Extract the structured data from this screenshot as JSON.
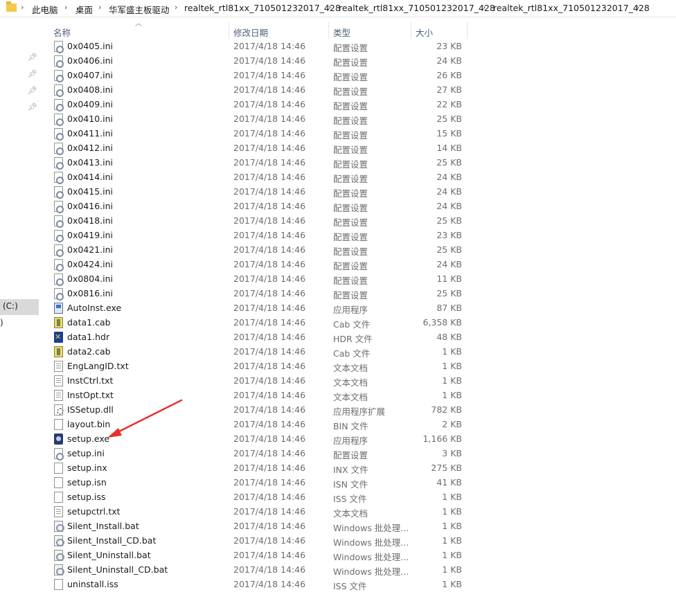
{
  "breadcrumb": {
    "items": [
      "此电脑",
      "桌面",
      "华军盛主板驱动",
      "realtek_rtl81xx_710501232017_428",
      "realtek_rtl81xx_710501232017_428",
      "realtek_rtl81xx_710501232017_428"
    ]
  },
  "nav": {
    "drive_c": "(C:)",
    "partial": ")"
  },
  "columns": {
    "name": "名称",
    "date": "修改日期",
    "type": "类型",
    "size": "大小"
  },
  "files": [
    {
      "name": "0x0405.ini",
      "date": "2017/4/18 14:46",
      "type": "配置设置",
      "size": "23 KB",
      "icon": "ini"
    },
    {
      "name": "0x0406.ini",
      "date": "2017/4/18 14:46",
      "type": "配置设置",
      "size": "24 KB",
      "icon": "ini"
    },
    {
      "name": "0x0407.ini",
      "date": "2017/4/18 14:46",
      "type": "配置设置",
      "size": "26 KB",
      "icon": "ini"
    },
    {
      "name": "0x0408.ini",
      "date": "2017/4/18 14:46",
      "type": "配置设置",
      "size": "27 KB",
      "icon": "ini"
    },
    {
      "name": "0x0409.ini",
      "date": "2017/4/18 14:46",
      "type": "配置设置",
      "size": "22 KB",
      "icon": "ini"
    },
    {
      "name": "0x0410.ini",
      "date": "2017/4/18 14:46",
      "type": "配置设置",
      "size": "25 KB",
      "icon": "ini"
    },
    {
      "name": "0x0411.ini",
      "date": "2017/4/18 14:46",
      "type": "配置设置",
      "size": "15 KB",
      "icon": "ini"
    },
    {
      "name": "0x0412.ini",
      "date": "2017/4/18 14:46",
      "type": "配置设置",
      "size": "14 KB",
      "icon": "ini"
    },
    {
      "name": "0x0413.ini",
      "date": "2017/4/18 14:46",
      "type": "配置设置",
      "size": "25 KB",
      "icon": "ini"
    },
    {
      "name": "0x0414.ini",
      "date": "2017/4/18 14:46",
      "type": "配置设置",
      "size": "24 KB",
      "icon": "ini"
    },
    {
      "name": "0x0415.ini",
      "date": "2017/4/18 14:46",
      "type": "配置设置",
      "size": "24 KB",
      "icon": "ini"
    },
    {
      "name": "0x0416.ini",
      "date": "2017/4/18 14:46",
      "type": "配置设置",
      "size": "24 KB",
      "icon": "ini"
    },
    {
      "name": "0x0418.ini",
      "date": "2017/4/18 14:46",
      "type": "配置设置",
      "size": "25 KB",
      "icon": "ini"
    },
    {
      "name": "0x0419.ini",
      "date": "2017/4/18 14:46",
      "type": "配置设置",
      "size": "23 KB",
      "icon": "ini"
    },
    {
      "name": "0x0421.ini",
      "date": "2017/4/18 14:46",
      "type": "配置设置",
      "size": "25 KB",
      "icon": "ini"
    },
    {
      "name": "0x0424.ini",
      "date": "2017/4/18 14:46",
      "type": "配置设置",
      "size": "24 KB",
      "icon": "ini"
    },
    {
      "name": "0x0804.ini",
      "date": "2017/4/18 14:46",
      "type": "配置设置",
      "size": "11 KB",
      "icon": "ini"
    },
    {
      "name": "0x0816.ini",
      "date": "2017/4/18 14:46",
      "type": "配置设置",
      "size": "25 KB",
      "icon": "ini"
    },
    {
      "name": "AutoInst.exe",
      "date": "2017/4/18 14:46",
      "type": "应用程序",
      "size": "87 KB",
      "icon": "exe"
    },
    {
      "name": "data1.cab",
      "date": "2017/4/18 14:46",
      "type": "Cab 文件",
      "size": "6,358 KB",
      "icon": "cab"
    },
    {
      "name": "data1.hdr",
      "date": "2017/4/18 14:46",
      "type": "HDR 文件",
      "size": "48 KB",
      "icon": "hdr"
    },
    {
      "name": "data2.cab",
      "date": "2017/4/18 14:46",
      "type": "Cab 文件",
      "size": "1 KB",
      "icon": "cab"
    },
    {
      "name": "EngLangID.txt",
      "date": "2017/4/18 14:46",
      "type": "文本文档",
      "size": "1 KB",
      "icon": "txt"
    },
    {
      "name": "InstCtrl.txt",
      "date": "2017/4/18 14:46",
      "type": "文本文档",
      "size": "1 KB",
      "icon": "txt"
    },
    {
      "name": "InstOpt.txt",
      "date": "2017/4/18 14:46",
      "type": "文本文档",
      "size": "1 KB",
      "icon": "txt"
    },
    {
      "name": "ISSetup.dll",
      "date": "2017/4/18 14:46",
      "type": "应用程序扩展",
      "size": "782 KB",
      "icon": "dll"
    },
    {
      "name": "layout.bin",
      "date": "2017/4/18 14:46",
      "type": "BIN 文件",
      "size": "2 KB",
      "icon": "blank"
    },
    {
      "name": "setup.exe",
      "date": "2017/4/18 14:46",
      "type": "应用程序",
      "size": "1,166 KB",
      "icon": "setup"
    },
    {
      "name": "setup.ini",
      "date": "2017/4/18 14:46",
      "type": "配置设置",
      "size": "3 KB",
      "icon": "ini"
    },
    {
      "name": "setup.inx",
      "date": "2017/4/18 14:46",
      "type": "INX 文件",
      "size": "275 KB",
      "icon": "blank"
    },
    {
      "name": "setup.isn",
      "date": "2017/4/18 14:46",
      "type": "ISN 文件",
      "size": "41 KB",
      "icon": "blank"
    },
    {
      "name": "setup.iss",
      "date": "2017/4/18 14:46",
      "type": "ISS 文件",
      "size": "1 KB",
      "icon": "blank"
    },
    {
      "name": "setupctrl.txt",
      "date": "2017/4/18 14:46",
      "type": "文本文档",
      "size": "1 KB",
      "icon": "txt"
    },
    {
      "name": "Silent_Install.bat",
      "date": "2017/4/18 14:46",
      "type": "Windows 批处理...",
      "size": "1 KB",
      "icon": "bat"
    },
    {
      "name": "Silent_Install_CD.bat",
      "date": "2017/4/18 14:46",
      "type": "Windows 批处理...",
      "size": "1 KB",
      "icon": "bat"
    },
    {
      "name": "Silent_Uninstall.bat",
      "date": "2017/4/18 14:46",
      "type": "Windows 批处理...",
      "size": "1 KB",
      "icon": "bat"
    },
    {
      "name": "Silent_Uninstall_CD.bat",
      "date": "2017/4/18 14:46",
      "type": "Windows 批处理...",
      "size": "1 KB",
      "icon": "bat"
    },
    {
      "name": "uninstall.iss",
      "date": "2017/4/18 14:46",
      "type": "ISS 文件",
      "size": "1 KB",
      "icon": "blank"
    }
  ],
  "annotation": {
    "color": "#e8302a"
  }
}
